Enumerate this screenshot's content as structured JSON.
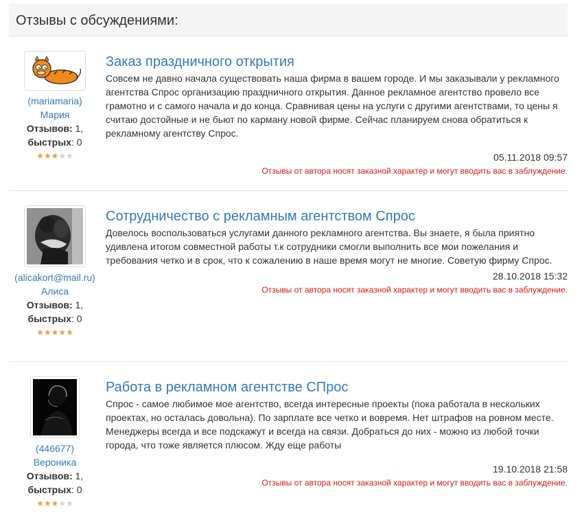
{
  "header": {
    "title": "Отзывы с обсуждениями:"
  },
  "reviews": [
    {
      "author": {
        "login": "(mariamaria)",
        "name": "Мария",
        "reviews_label": "Отзывов:",
        "reviews_count": " 1,",
        "quick_label": "быстрых",
        "quick_count": ": 0",
        "rating": 3,
        "avatar_icon": "garfield-avatar-icon"
      },
      "title": "Заказ праздничного открытия",
      "text": "Совсем не давно начала существовать наша фирма в вашем городе. И мы заказывали у рекламного агентства Спрос организацию праздничного открытия. Данное рекламное агентство провело все грамотно и с самого начала и до конца. Сравнивая цены на услуги с другими агентствами, то цены я считаю достойные и не бьют по карману новой фирме. Сейчас планируем снова обратиться к рекламному агентству Спрос.",
      "date": "05.11.2018 09:57",
      "warning": "Отзывы от автора носят заказной характер и могут вводить вас в заблуждение."
    },
    {
      "author": {
        "login": "(alicakort@mail.ru)",
        "name": "Алиса",
        "reviews_label": "Отзывов:",
        "reviews_count": " 1,",
        "quick_label": "быстрых",
        "quick_count": ": 0",
        "rating": 5,
        "avatar_icon": "couple-photo-avatar-icon"
      },
      "title": "Сотрудничество с рекламным агентством Спрос",
      "text": "Довелось воспользоваться услугами данного рекламного агентства. Вы знаете, я была приятно удивлена итогом совместной работы т.к сотрудники смогли выполнить все мои пожелания и требования четко и в срок, что к сожалению в наше время могут не многие. Советую фирму Спрос.",
      "date": "28.10.2018 15:32",
      "warning": "Отзывы от автора носят заказной характер и могут вводить вас в заблуждение."
    },
    {
      "author": {
        "login": "(446677)",
        "name": "Вероника",
        "reviews_label": "Отзывов:",
        "reviews_count": " 1,",
        "quick_label": "быстрых",
        "quick_count": ": 0",
        "rating": 3,
        "avatar_icon": "silhouette-photo-avatar-icon"
      },
      "title": "Работа в рекламном агентстве СПрос",
      "text": "Спрос - самое любимое мое агентство, всегда интересные проекты (пока работала в нескольких проектах, но осталась довольна). По зарплате все четко и вовремя. Нет штрафов на ровном месте. Менеджеры всегда и все подскажут и всегда на связи. Добраться до них - можно из любой точки города, что тоже является плюсом. Жду еще работы",
      "date": "19.10.2018 21:58",
      "warning": "Отзывы от автора носят заказной характер и могут вводить вас в заблуждение."
    }
  ]
}
